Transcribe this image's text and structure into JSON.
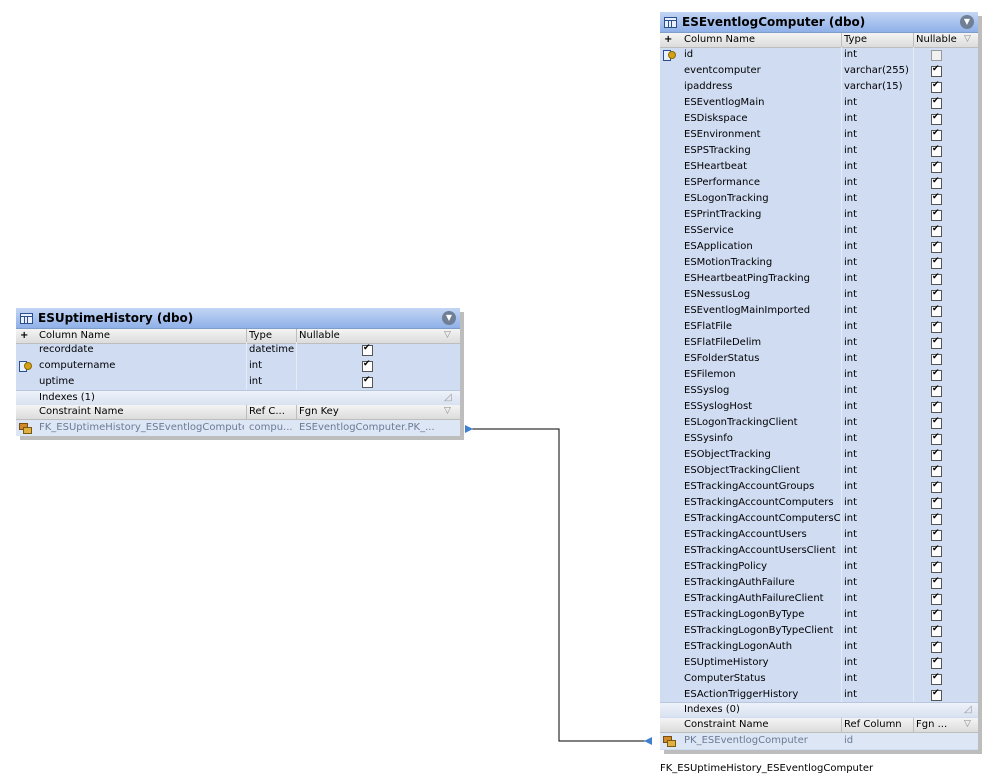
{
  "left_table": {
    "title": "ESUptimeHistory (dbo)",
    "columns_header": {
      "name": "Column Name",
      "type": "Type",
      "nullable": "Nullable"
    },
    "rows": [
      {
        "name": "recorddate",
        "type": "datetime",
        "nullable": true,
        "key": false
      },
      {
        "name": "computername",
        "type": "int",
        "nullable": true,
        "key": true
      },
      {
        "name": "uptime",
        "type": "int",
        "nullable": true,
        "key": false
      }
    ],
    "indexes_label": "Indexes (1)",
    "constraints_header": {
      "name": "Constraint Name",
      "ref": "Ref C...",
      "fgn": "Fgn Key"
    },
    "constraints": [
      {
        "name": "FK_ESUptimeHistory_ESEventlogComputer",
        "ref": "compu...",
        "fgn": "ESEventlogComputer.PK_..."
      }
    ]
  },
  "right_table": {
    "title": "ESEventlogComputer (dbo)",
    "columns_header": {
      "name": "Column Name",
      "type": "Type",
      "nullable": "Nullable"
    },
    "rows": [
      {
        "name": "id",
        "type": "int",
        "nullable": false,
        "key": true
      },
      {
        "name": "eventcomputer",
        "type": "varchar(255)",
        "nullable": true,
        "key": false
      },
      {
        "name": "ipaddress",
        "type": "varchar(15)",
        "nullable": true,
        "key": false
      },
      {
        "name": "ESEventlogMain",
        "type": "int",
        "nullable": true,
        "key": false
      },
      {
        "name": "ESDiskspace",
        "type": "int",
        "nullable": true,
        "key": false
      },
      {
        "name": "ESEnvironment",
        "type": "int",
        "nullable": true,
        "key": false
      },
      {
        "name": "ESPSTracking",
        "type": "int",
        "nullable": true,
        "key": false
      },
      {
        "name": "ESHeartbeat",
        "type": "int",
        "nullable": true,
        "key": false
      },
      {
        "name": "ESPerformance",
        "type": "int",
        "nullable": true,
        "key": false
      },
      {
        "name": "ESLogonTracking",
        "type": "int",
        "nullable": true,
        "key": false
      },
      {
        "name": "ESPrintTracking",
        "type": "int",
        "nullable": true,
        "key": false
      },
      {
        "name": "ESService",
        "type": "int",
        "nullable": true,
        "key": false
      },
      {
        "name": "ESApplication",
        "type": "int",
        "nullable": true,
        "key": false
      },
      {
        "name": "ESMotionTracking",
        "type": "int",
        "nullable": true,
        "key": false
      },
      {
        "name": "ESHeartbeatPingTracking",
        "type": "int",
        "nullable": true,
        "key": false
      },
      {
        "name": "ESNessusLog",
        "type": "int",
        "nullable": true,
        "key": false
      },
      {
        "name": "ESEventlogMainImported",
        "type": "int",
        "nullable": true,
        "key": false
      },
      {
        "name": "ESFlatFile",
        "type": "int",
        "nullable": true,
        "key": false
      },
      {
        "name": "ESFlatFileDelim",
        "type": "int",
        "nullable": true,
        "key": false
      },
      {
        "name": "ESFolderStatus",
        "type": "int",
        "nullable": true,
        "key": false
      },
      {
        "name": "ESFilemon",
        "type": "int",
        "nullable": true,
        "key": false
      },
      {
        "name": "ESSyslog",
        "type": "int",
        "nullable": true,
        "key": false
      },
      {
        "name": "ESSyslogHost",
        "type": "int",
        "nullable": true,
        "key": false
      },
      {
        "name": "ESLogonTrackingClient",
        "type": "int",
        "nullable": true,
        "key": false
      },
      {
        "name": "ESSysinfo",
        "type": "int",
        "nullable": true,
        "key": false
      },
      {
        "name": "ESObjectTracking",
        "type": "int",
        "nullable": true,
        "key": false
      },
      {
        "name": "ESObjectTrackingClient",
        "type": "int",
        "nullable": true,
        "key": false
      },
      {
        "name": "ESTrackingAccountGroups",
        "type": "int",
        "nullable": true,
        "key": false
      },
      {
        "name": "ESTrackingAccountComputers",
        "type": "int",
        "nullable": true,
        "key": false
      },
      {
        "name": "ESTrackingAccountComputersCli",
        "type": "int",
        "nullable": true,
        "key": false
      },
      {
        "name": "ESTrackingAccountUsers",
        "type": "int",
        "nullable": true,
        "key": false
      },
      {
        "name": "ESTrackingAccountUsersClient",
        "type": "int",
        "nullable": true,
        "key": false
      },
      {
        "name": "ESTrackingPolicy",
        "type": "int",
        "nullable": true,
        "key": false
      },
      {
        "name": "ESTrackingAuthFailure",
        "type": "int",
        "nullable": true,
        "key": false
      },
      {
        "name": "ESTrackingAuthFailureClient",
        "type": "int",
        "nullable": true,
        "key": false
      },
      {
        "name": "ESTrackingLogonByType",
        "type": "int",
        "nullable": true,
        "key": false
      },
      {
        "name": "ESTrackingLogonByTypeClient",
        "type": "int",
        "nullable": true,
        "key": false
      },
      {
        "name": "ESTrackingLogonAuth",
        "type": "int",
        "nullable": true,
        "key": false
      },
      {
        "name": "ESUptimeHistory",
        "type": "int",
        "nullable": true,
        "key": false
      },
      {
        "name": "ComputerStatus",
        "type": "int",
        "nullable": true,
        "key": false
      },
      {
        "name": "ESActionTriggerHistory",
        "type": "int",
        "nullable": true,
        "key": false
      }
    ],
    "indexes_label": "Indexes (0)",
    "constraints_header": {
      "name": "Constraint Name",
      "ref": "Ref Column",
      "fgn": "Fgn ..."
    },
    "constraints": [
      {
        "name": "PK_ESEventlogComputer",
        "ref": "id",
        "fgn": ""
      }
    ]
  },
  "relationship_label": "FK_ESUptimeHistory_ESEventlogComputer"
}
